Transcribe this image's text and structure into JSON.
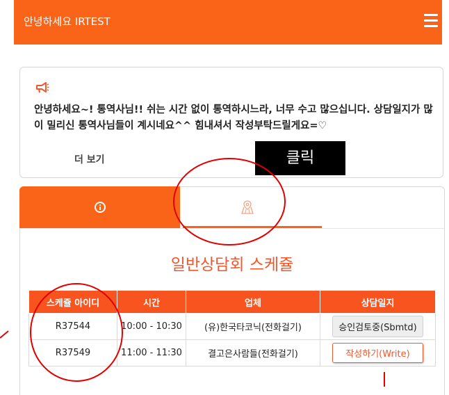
{
  "header": {
    "title": "안녕하세요 IRTEST",
    "menu_icon": "hamburger-menu-icon",
    "background": "#fa6419"
  },
  "notice": {
    "icon": "megaphone-icon",
    "message": "안녕하세요~! 통역사님!! 쉬는 시간 없이 통역하시느라, 너무 수고 많으십니다. 상담일지가 많이 밀리신 통역사님들이 계시네요^^ 힘내셔서 작성부탁드릴게요=♡",
    "more_label": "더 보기"
  },
  "annotation": {
    "click_label": "클릭"
  },
  "tabs": [
    {
      "icon": "info-icon",
      "active": true
    },
    {
      "icon": "map-icon",
      "active": false
    }
  ],
  "schedule": {
    "title": "일반상담회 스케쥴",
    "columns": [
      "스케쥴 아이디",
      "시간",
      "업체",
      "상담일지"
    ],
    "rows": [
      {
        "id": "R37544",
        "time": "10:00 - 10:30",
        "company": "(유)한국타코닉(전화걸기)",
        "status": "승인검토중(Sbmtd)",
        "action": "none"
      },
      {
        "id": "R37549",
        "time": "11:00 - 11:30",
        "company": "결고은사람들(전화걸기)",
        "status": "작성하기(Write)",
        "action": "write"
      }
    ]
  },
  "colors": {
    "accent": "#fa6419",
    "annotation_red": "#e00000"
  }
}
